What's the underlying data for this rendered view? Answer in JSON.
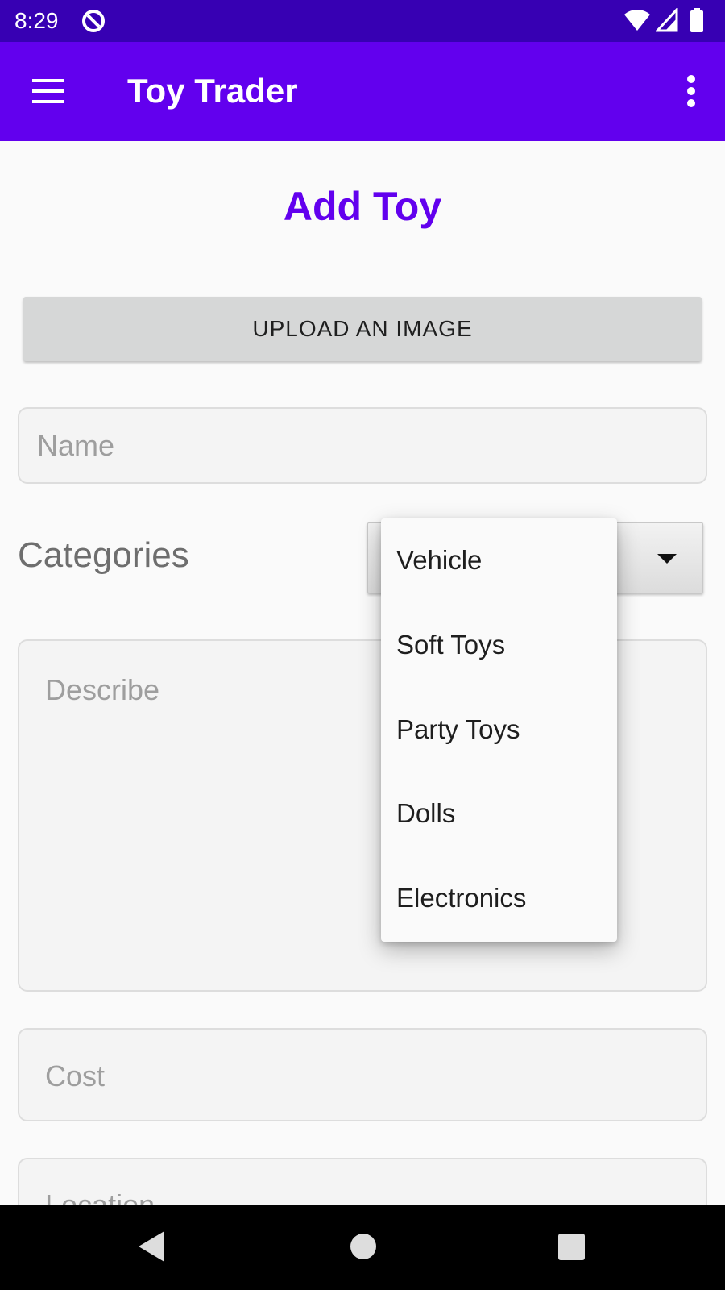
{
  "status_bar": {
    "time": "8:29",
    "icons": [
      "app-notification-icon",
      "wifi-icon",
      "cell-signal-icon",
      "battery-icon"
    ]
  },
  "app_bar": {
    "title": "Toy Trader",
    "menu_icon": "hamburger-menu-icon",
    "overflow_icon": "more-vert-icon"
  },
  "page": {
    "title": "Add Toy",
    "upload_button_label": "UPLOAD AN IMAGE",
    "name_placeholder": "Name",
    "categories_label": "Categories",
    "describe_placeholder": "Describe",
    "cost_placeholder": "Cost",
    "location_placeholder": "Location"
  },
  "category_dropdown": {
    "options": [
      "Vehicle",
      "Soft Toys",
      "Party Toys",
      "Dolls",
      "Electronics"
    ]
  },
  "nav_bar": {
    "icons": [
      "back-icon",
      "home-icon",
      "recents-icon"
    ]
  },
  "colors": {
    "status_bar": "#3700B3",
    "primary": "#6200EE",
    "background": "#FAFAFA",
    "button": "#D6D7D7",
    "nav_bar": "#000000"
  }
}
